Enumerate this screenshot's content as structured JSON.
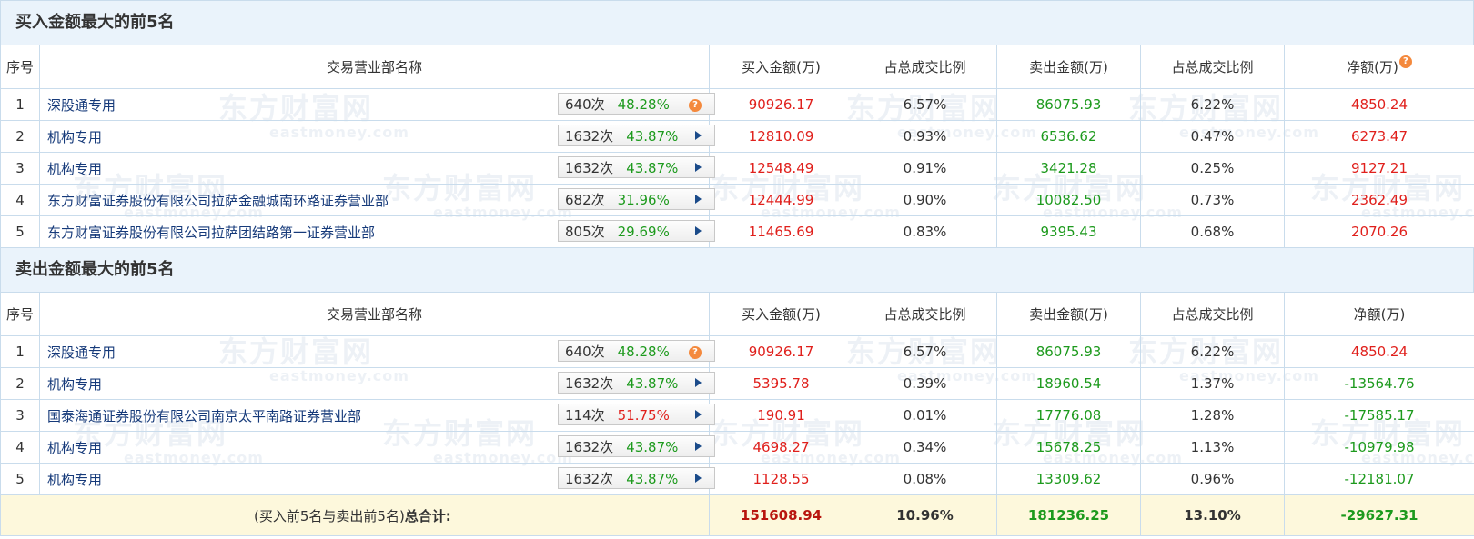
{
  "watermark": {
    "brand": "东方财富网",
    "domain": "eastmoney.com"
  },
  "buy_section": {
    "title": "买入金额最大的前5名",
    "headers": {
      "idx": "序号",
      "name": "交易营业部名称",
      "buy": "买入金额(万)",
      "buy_pct": "占总成交比例",
      "sell": "卖出金额(万)",
      "sell_pct": "占总成交比例",
      "net": "净额(万)"
    },
    "rows": [
      {
        "idx": "1",
        "name": "深股通专用",
        "count": "640次",
        "pct": "48.28%",
        "buy": "90926.17",
        "buy_pct": "6.57%",
        "sell": "86075.93",
        "sell_pct": "6.22%",
        "net": "4850.24"
      },
      {
        "idx": "2",
        "name": "机构专用",
        "count": "1632次",
        "pct": "43.87%",
        "buy": "12810.09",
        "buy_pct": "0.93%",
        "sell": "6536.62",
        "sell_pct": "0.47%",
        "net": "6273.47"
      },
      {
        "idx": "3",
        "name": "机构专用",
        "count": "1632次",
        "pct": "43.87%",
        "buy": "12548.49",
        "buy_pct": "0.91%",
        "sell": "3421.28",
        "sell_pct": "0.25%",
        "net": "9127.21"
      },
      {
        "idx": "4",
        "name": "东方财富证券股份有限公司拉萨金融城南环路证券营业部",
        "count": "682次",
        "pct": "31.96%",
        "buy": "12444.99",
        "buy_pct": "0.90%",
        "sell": "10082.50",
        "sell_pct": "0.73%",
        "net": "2362.49"
      },
      {
        "idx": "5",
        "name": "东方财富证券股份有限公司拉萨团结路第一证券营业部",
        "count": "805次",
        "pct": "29.69%",
        "buy": "11465.69",
        "buy_pct": "0.83%",
        "sell": "9395.43",
        "sell_pct": "0.68%",
        "net": "2070.26"
      }
    ]
  },
  "sell_section": {
    "title": "卖出金额最大的前5名",
    "headers": {
      "idx": "序号",
      "name": "交易营业部名称",
      "buy": "买入金额(万)",
      "buy_pct": "占总成交比例",
      "sell": "卖出金额(万)",
      "sell_pct": "占总成交比例",
      "net": "净额(万)"
    },
    "rows": [
      {
        "idx": "1",
        "name": "深股通专用",
        "count": "640次",
        "pct": "48.28%",
        "buy": "90926.17",
        "buy_pct": "6.57%",
        "sell": "86075.93",
        "sell_pct": "6.22%",
        "net": "4850.24"
      },
      {
        "idx": "2",
        "name": "机构专用",
        "count": "1632次",
        "pct": "43.87%",
        "buy": "5395.78",
        "buy_pct": "0.39%",
        "sell": "18960.54",
        "sell_pct": "1.37%",
        "net": "-13564.76"
      },
      {
        "idx": "3",
        "name": "国泰海通证券股份有限公司南京太平南路证券营业部",
        "count": "114次",
        "pct": "51.75%",
        "buy": "190.91",
        "buy_pct": "0.01%",
        "sell": "17776.08",
        "sell_pct": "1.28%",
        "net": "-17585.17"
      },
      {
        "idx": "4",
        "name": "机构专用",
        "count": "1632次",
        "pct": "43.87%",
        "buy": "4698.27",
        "buy_pct": "0.34%",
        "sell": "15678.25",
        "sell_pct": "1.13%",
        "net": "-10979.98"
      },
      {
        "idx": "5",
        "name": "机构专用",
        "count": "1632次",
        "pct": "43.87%",
        "buy": "1128.55",
        "buy_pct": "0.08%",
        "sell": "13309.62",
        "sell_pct": "0.96%",
        "net": "-12181.07"
      }
    ]
  },
  "total": {
    "label_prefix": "(买入前5名与卖出前5名)",
    "label_bold": "总合计:",
    "buy": "151608.94",
    "buy_pct": "10.96%",
    "sell": "181236.25",
    "sell_pct": "13.10%",
    "net": "-29627.31"
  },
  "colors": {
    "header_bg": "#eaf3fb",
    "border": "#c9dcec",
    "buy_red": "#e0201c",
    "sell_green": "#1d9a1d",
    "total_bg": "#fdf8dc",
    "name_blue": "#163a7a",
    "help_orange": "#f4893d"
  }
}
